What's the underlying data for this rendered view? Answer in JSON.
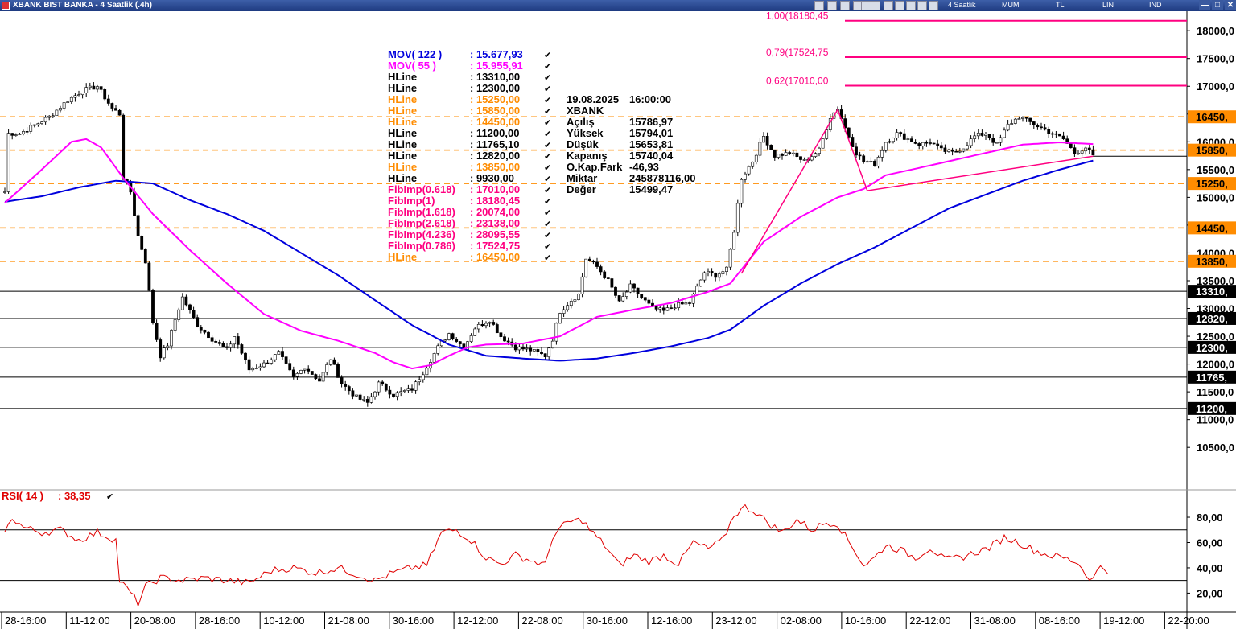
{
  "window": {
    "title": "XBANK BIST BANKA - 4 Saatlik (.4h)",
    "toolbar": {
      "period": "4 Saatlik",
      "candle": "MUM",
      "currency": "TL",
      "scale": "LIN",
      "ind": "IND"
    },
    "buttons": [
      "—",
      "□",
      "✕"
    ]
  },
  "colors": {
    "mov122": "#0000dd",
    "mov55": "#ff00ff",
    "hline_black": "#000000",
    "hline_orange": "#ff8c00",
    "fib": "#ff0080",
    "rsi": "#e00000",
    "candle": "#000000"
  },
  "chart_data": [
    {
      "type": "line",
      "subtype": "candlestick",
      "ylim": [
        9750,
        18350
      ],
      "yticks": [
        18000,
        17500,
        17000,
        16500,
        16000,
        15500,
        15000,
        14500,
        14000,
        13500,
        13000,
        12500,
        12000,
        11500,
        11000,
        10500
      ],
      "ytick_labels": [
        "18000,0",
        "17500,0",
        "17000,0",
        "16500,0",
        "16000,0",
        "15500,0",
        "15000,0",
        "14500,0",
        "14000,0",
        "13500,0",
        "13000,0",
        "12500,0",
        "12000,0",
        "11500,0",
        "11000,0",
        "10500,0"
      ],
      "xtick_labels": [
        "28-16:00",
        "11-12:00",
        "20-08:00",
        "28-16:00",
        "10-12:00",
        "21-08:00",
        "30-16:00",
        "12-12:00",
        "22-08:00",
        "30-16:00",
        "12-16:00",
        "23-12:00",
        "02-08:00",
        "10-16:00",
        "22-12:00",
        "31-08:00",
        "08-16:00",
        "19-12:00",
        "22-20:00"
      ],
      "close_keypoints": [
        [
          0,
          15100
        ],
        [
          1,
          16150
        ],
        [
          4,
          16150
        ],
        [
          8,
          16300
        ],
        [
          12,
          16450
        ],
        [
          17,
          16750
        ],
        [
          21,
          16920
        ],
        [
          25,
          17000
        ],
        [
          29,
          16600
        ],
        [
          31,
          16500
        ],
        [
          32,
          15350
        ],
        [
          34,
          15100
        ],
        [
          36,
          14300
        ],
        [
          38,
          13850
        ],
        [
          40,
          12750
        ],
        [
          42,
          12150
        ],
        [
          44,
          12350
        ],
        [
          46,
          12800
        ],
        [
          48,
          13200
        ],
        [
          52,
          12700
        ],
        [
          56,
          12450
        ],
        [
          60,
          12250
        ],
        [
          62,
          12500
        ],
        [
          66,
          11900
        ],
        [
          70,
          12000
        ],
        [
          74,
          12200
        ],
        [
          78,
          11750
        ],
        [
          81,
          11950
        ],
        [
          85,
          11700
        ],
        [
          88,
          12100
        ],
        [
          91,
          11650
        ],
        [
          95,
          11400
        ],
        [
          98,
          11300
        ],
        [
          101,
          11650
        ],
        [
          105,
          11450
        ],
        [
          110,
          11550
        ],
        [
          113,
          11850
        ],
        [
          117,
          12300
        ],
        [
          120,
          12550
        ],
        [
          124,
          12300
        ],
        [
          127,
          12650
        ],
        [
          131,
          12800
        ],
        [
          134,
          12500
        ],
        [
          138,
          12300
        ],
        [
          142,
          12250
        ],
        [
          146,
          12150
        ],
        [
          148,
          12450
        ],
        [
          150,
          12950
        ],
        [
          153,
          13150
        ],
        [
          155,
          13250
        ],
        [
          157,
          13900
        ],
        [
          160,
          13750
        ],
        [
          163,
          13500
        ],
        [
          166,
          13100
        ],
        [
          169,
          13400
        ],
        [
          172,
          13200
        ],
        [
          175,
          13000
        ],
        [
          178,
          12950
        ],
        [
          181,
          13050
        ],
        [
          185,
          13100
        ],
        [
          189,
          13650
        ],
        [
          192,
          13600
        ],
        [
          195,
          13700
        ],
        [
          197,
          14400
        ],
        [
          199,
          15350
        ],
        [
          202,
          15650
        ],
        [
          205,
          16100
        ],
        [
          208,
          15750
        ],
        [
          212,
          15800
        ],
        [
          216,
          15650
        ],
        [
          220,
          15850
        ],
        [
          223,
          16450
        ],
        [
          225,
          16600
        ],
        [
          227,
          16250
        ],
        [
          230,
          15800
        ],
        [
          232,
          15650
        ],
        [
          235,
          15600
        ],
        [
          238,
          16000
        ],
        [
          241,
          16150
        ],
        [
          244,
          16050
        ],
        [
          247,
          15950
        ],
        [
          250,
          16000
        ],
        [
          253,
          15850
        ],
        [
          256,
          15800
        ],
        [
          259,
          15900
        ],
        [
          262,
          16100
        ],
        [
          265,
          16150
        ],
        [
          268,
          15950
        ],
        [
          271,
          16300
        ],
        [
          274,
          16450
        ],
        [
          277,
          16350
        ],
        [
          280,
          16250
        ],
        [
          283,
          16150
        ],
        [
          286,
          16050
        ],
        [
          289,
          15800
        ],
        [
          292,
          15900
        ],
        [
          294,
          15740
        ]
      ],
      "mov122_keypoints": [
        [
          0,
          14920
        ],
        [
          10,
          15020
        ],
        [
          20,
          15180
        ],
        [
          30,
          15300
        ],
        [
          40,
          15250
        ],
        [
          50,
          14950
        ],
        [
          60,
          14700
        ],
        [
          70,
          14400
        ],
        [
          80,
          14000
        ],
        [
          90,
          13600
        ],
        [
          100,
          13150
        ],
        [
          110,
          12700
        ],
        [
          120,
          12350
        ],
        [
          130,
          12150
        ],
        [
          140,
          12100
        ],
        [
          150,
          12060
        ],
        [
          160,
          12100
        ],
        [
          170,
          12200
        ],
        [
          180,
          12320
        ],
        [
          190,
          12470
        ],
        [
          196,
          12620
        ],
        [
          205,
          13050
        ],
        [
          215,
          13450
        ],
        [
          225,
          13800
        ],
        [
          235,
          14100
        ],
        [
          245,
          14450
        ],
        [
          255,
          14800
        ],
        [
          265,
          15050
        ],
        [
          275,
          15300
        ],
        [
          285,
          15500
        ],
        [
          295,
          15680
        ]
      ],
      "mov55_keypoints": [
        [
          0,
          14900
        ],
        [
          10,
          15500
        ],
        [
          18,
          16000
        ],
        [
          22,
          16050
        ],
        [
          26,
          15900
        ],
        [
          32,
          15350
        ],
        [
          40,
          14700
        ],
        [
          50,
          14050
        ],
        [
          60,
          13450
        ],
        [
          70,
          12900
        ],
        [
          80,
          12600
        ],
        [
          90,
          12420
        ],
        [
          100,
          12200
        ],
        [
          105,
          12030
        ],
        [
          110,
          11920
        ],
        [
          115,
          11980
        ],
        [
          120,
          12150
        ],
        [
          125,
          12300
        ],
        [
          130,
          12350
        ],
        [
          140,
          12370
        ],
        [
          150,
          12500
        ],
        [
          160,
          12850
        ],
        [
          170,
          12980
        ],
        [
          180,
          13100
        ],
        [
          190,
          13300
        ],
        [
          196,
          13450
        ],
        [
          205,
          14200
        ],
        [
          215,
          14650
        ],
        [
          225,
          15000
        ],
        [
          232,
          15150
        ],
        [
          238,
          15400
        ],
        [
          245,
          15500
        ],
        [
          255,
          15650
        ],
        [
          265,
          15800
        ],
        [
          275,
          15950
        ],
        [
          285,
          15990
        ],
        [
          295,
          15956
        ]
      ],
      "fibo_line": [
        [
          199,
          13630
        ],
        [
          225,
          16580
        ],
        [
          233,
          15120
        ],
        [
          294,
          15740
        ]
      ],
      "legend": [
        {
          "label": "MOV( 122 )",
          "value": ": 15.677,93",
          "color": "#0000dd"
        },
        {
          "label": "MOV( 55 )",
          "value": ": 15.955,91",
          "color": "#ff00ff"
        },
        {
          "label": "HLine",
          "value": ": 13310,00",
          "color": "#000000"
        },
        {
          "label": "HLine",
          "value": ": 12300,00",
          "color": "#000000"
        },
        {
          "label": "HLine",
          "value": ": 15250,00",
          "color": "#ff8c00"
        },
        {
          "label": "HLine",
          "value": ": 15850,00",
          "color": "#ff8c00"
        },
        {
          "label": "HLine",
          "value": ": 14450,00",
          "color": "#ff8c00"
        },
        {
          "label": "HLine",
          "value": ": 11200,00",
          "color": "#000000"
        },
        {
          "label": "HLine",
          "value": ": 11765,10",
          "color": "#000000"
        },
        {
          "label": "HLine",
          "value": ": 12820,00",
          "color": "#000000"
        },
        {
          "label": "HLine",
          "value": ": 13850,00",
          "color": "#ff8c00"
        },
        {
          "label": "HLine",
          "value": ": 9930,00",
          "color": "#000000"
        },
        {
          "label": "FibImp(0.618)",
          "value": ": 17010,00",
          "color": "#ff0080"
        },
        {
          "label": "FibImp(1)",
          "value": ": 18180,45",
          "color": "#ff0080"
        },
        {
          "label": "FibImp(1.618)",
          "value": ": 20074,00",
          "color": "#ff0080"
        },
        {
          "label": "FibImp(2.618)",
          "value": ": 23138,00",
          "color": "#ff0080"
        },
        {
          "label": "FibImp(4.236)",
          "value": ": 28095,55",
          "color": "#ff0080"
        },
        {
          "label": "FibImp(0.786)",
          "value": ": 17524,75",
          "color": "#ff0080"
        },
        {
          "label": "HLine",
          "value": ": 16450,00",
          "color": "#ff8c00"
        }
      ],
      "info_box": [
        {
          "label": "19.08.2025",
          "value": "16:00:00"
        },
        {
          "label": "XBANK",
          "value": ""
        },
        {
          "label": "Açılış",
          "value": "15786,97"
        },
        {
          "label": "Yüksek",
          "value": "15794,01"
        },
        {
          "label": "Düşük",
          "value": "15653,81"
        },
        {
          "label": "Kapanış",
          "value": "15740,04"
        },
        {
          "label": "O.Kap.Fark",
          "value": "-46,93"
        },
        {
          "label": "Miktar",
          "value": "245878116,00"
        },
        {
          "label": "Değer",
          "value": "15499,47"
        }
      ],
      "hlines_solid": [
        {
          "value": 13310,
          "label": "13310,"
        },
        {
          "value": 12820,
          "label": "12820,"
        },
        {
          "value": 12300,
          "label": "12300,"
        },
        {
          "value": 11765,
          "label": "11765,"
        },
        {
          "value": 11200,
          "label": "11200,"
        }
      ],
      "hlines_dashed": [
        {
          "value": 16450,
          "label": "16450,"
        },
        {
          "value": 15850,
          "label": "15850,"
        },
        {
          "value": 15250,
          "label": "15250,"
        },
        {
          "value": 14450,
          "label": "14450,"
        },
        {
          "value": 13850,
          "label": "13850,"
        }
      ],
      "fib_lines": [
        {
          "value": 18180.45,
          "label": "1,00(18180,45"
        },
        {
          "value": 17524.75,
          "label": "0,79(17524,75"
        },
        {
          "value": 17010,
          "label": "0,62(17010,00"
        }
      ],
      "last_price": 15740
    },
    {
      "type": "line",
      "title": "RSI( 14 )",
      "value_label": ": 38,35",
      "ylim": [
        5,
        101
      ],
      "yticks": [
        80,
        60,
        40,
        20
      ],
      "ytick_labels": [
        "80,00",
        "60,00",
        "40,00",
        "20,00"
      ],
      "hlines": [
        70,
        30
      ],
      "rsi_keypoints": [
        [
          0,
          67
        ],
        [
          2,
          80
        ],
        [
          5,
          72
        ],
        [
          10,
          68
        ],
        [
          15,
          70
        ],
        [
          20,
          62
        ],
        [
          25,
          68
        ],
        [
          30,
          62
        ],
        [
          31,
          30
        ],
        [
          34,
          20
        ],
        [
          36,
          12
        ],
        [
          38,
          25
        ],
        [
          42,
          32
        ],
        [
          48,
          30
        ],
        [
          54,
          32
        ],
        [
          60,
          30
        ],
        [
          66,
          28
        ],
        [
          72,
          38
        ],
        [
          78,
          40
        ],
        [
          84,
          36
        ],
        [
          90,
          40
        ],
        [
          96,
          34
        ],
        [
          100,
          30
        ],
        [
          105,
          36
        ],
        [
          110,
          40
        ],
        [
          114,
          42
        ],
        [
          118,
          68
        ],
        [
          122,
          70
        ],
        [
          126,
          62
        ],
        [
          130,
          48
        ],
        [
          134,
          43
        ],
        [
          138,
          50
        ],
        [
          142,
          46
        ],
        [
          146,
          42
        ],
        [
          148,
          65
        ],
        [
          152,
          76
        ],
        [
          156,
          78
        ],
        [
          158,
          70
        ],
        [
          162,
          58
        ],
        [
          166,
          42
        ],
        [
          170,
          50
        ],
        [
          174,
          45
        ],
        [
          178,
          50
        ],
        [
          182,
          43
        ],
        [
          186,
          60
        ],
        [
          190,
          55
        ],
        [
          194,
          62
        ],
        [
          197,
          82
        ],
        [
          200,
          88
        ],
        [
          203,
          84
        ],
        [
          206,
          76
        ],
        [
          210,
          68
        ],
        [
          214,
          78
        ],
        [
          218,
          70
        ],
        [
          222,
          76
        ],
        [
          225,
          75
        ],
        [
          227,
          65
        ],
        [
          230,
          52
        ],
        [
          232,
          42
        ],
        [
          235,
          48
        ],
        [
          238,
          58
        ],
        [
          242,
          54
        ],
        [
          246,
          48
        ],
        [
          250,
          56
        ],
        [
          254,
          46
        ],
        [
          258,
          48
        ],
        [
          262,
          52
        ],
        [
          266,
          56
        ],
        [
          270,
          64
        ],
        [
          274,
          60
        ],
        [
          278,
          54
        ],
        [
          282,
          50
        ],
        [
          286,
          48
        ],
        [
          290,
          44
        ],
        [
          292,
          35
        ],
        [
          294,
          31
        ],
        [
          296,
          42
        ],
        [
          298,
          38
        ]
      ]
    }
  ]
}
